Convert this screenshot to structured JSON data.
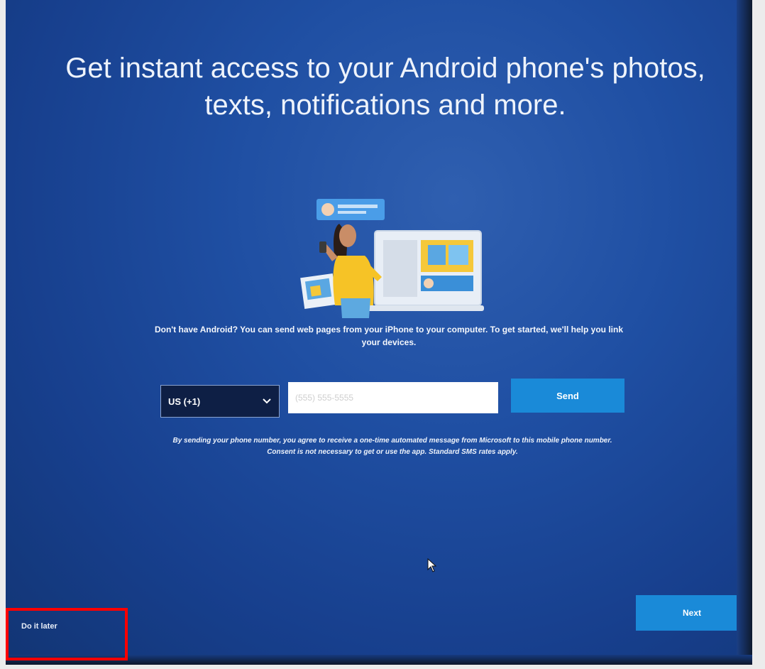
{
  "headline": "Get instant access to your Android phone's photos, texts, notifications and more.",
  "info_text": "Don't have Android? You can send web pages from your iPhone to your computer. To get started, we'll help you link your devices.",
  "country_select": {
    "value": "US (+1)"
  },
  "phone_input": {
    "placeholder": "(555) 555-5555"
  },
  "send_button": {
    "label": "Send"
  },
  "consent_text": "By sending your phone number, you agree to receive a one-time automated message from Microsoft to this mobile phone number. Consent is not necessary to get or use the app. Standard SMS rates apply.",
  "next_button": {
    "label": "Next"
  },
  "do_it_later": {
    "label": "Do it later"
  },
  "colors": {
    "background": "#1f4fa3",
    "accent": "#1a8ad8",
    "highlight": "#ff0000"
  }
}
